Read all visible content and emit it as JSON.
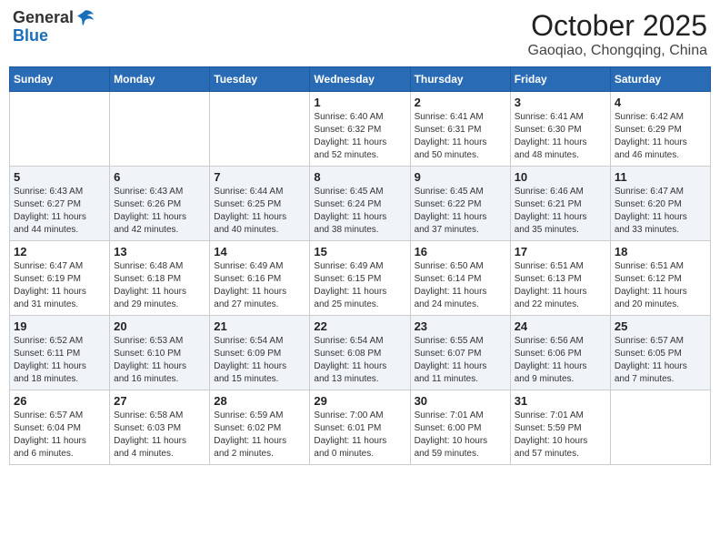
{
  "header": {
    "logo_general": "General",
    "logo_blue": "Blue",
    "month_title": "October 2025",
    "location": "Gaoqiao, Chongqing, China"
  },
  "weekdays": [
    "Sunday",
    "Monday",
    "Tuesday",
    "Wednesday",
    "Thursday",
    "Friday",
    "Saturday"
  ],
  "weeks": [
    [
      {
        "day": "",
        "info": ""
      },
      {
        "day": "",
        "info": ""
      },
      {
        "day": "",
        "info": ""
      },
      {
        "day": "1",
        "info": "Sunrise: 6:40 AM\nSunset: 6:32 PM\nDaylight: 11 hours\nand 52 minutes."
      },
      {
        "day": "2",
        "info": "Sunrise: 6:41 AM\nSunset: 6:31 PM\nDaylight: 11 hours\nand 50 minutes."
      },
      {
        "day": "3",
        "info": "Sunrise: 6:41 AM\nSunset: 6:30 PM\nDaylight: 11 hours\nand 48 minutes."
      },
      {
        "day": "4",
        "info": "Sunrise: 6:42 AM\nSunset: 6:29 PM\nDaylight: 11 hours\nand 46 minutes."
      }
    ],
    [
      {
        "day": "5",
        "info": "Sunrise: 6:43 AM\nSunset: 6:27 PM\nDaylight: 11 hours\nand 44 minutes."
      },
      {
        "day": "6",
        "info": "Sunrise: 6:43 AM\nSunset: 6:26 PM\nDaylight: 11 hours\nand 42 minutes."
      },
      {
        "day": "7",
        "info": "Sunrise: 6:44 AM\nSunset: 6:25 PM\nDaylight: 11 hours\nand 40 minutes."
      },
      {
        "day": "8",
        "info": "Sunrise: 6:45 AM\nSunset: 6:24 PM\nDaylight: 11 hours\nand 38 minutes."
      },
      {
        "day": "9",
        "info": "Sunrise: 6:45 AM\nSunset: 6:22 PM\nDaylight: 11 hours\nand 37 minutes."
      },
      {
        "day": "10",
        "info": "Sunrise: 6:46 AM\nSunset: 6:21 PM\nDaylight: 11 hours\nand 35 minutes."
      },
      {
        "day": "11",
        "info": "Sunrise: 6:47 AM\nSunset: 6:20 PM\nDaylight: 11 hours\nand 33 minutes."
      }
    ],
    [
      {
        "day": "12",
        "info": "Sunrise: 6:47 AM\nSunset: 6:19 PM\nDaylight: 11 hours\nand 31 minutes."
      },
      {
        "day": "13",
        "info": "Sunrise: 6:48 AM\nSunset: 6:18 PM\nDaylight: 11 hours\nand 29 minutes."
      },
      {
        "day": "14",
        "info": "Sunrise: 6:49 AM\nSunset: 6:16 PM\nDaylight: 11 hours\nand 27 minutes."
      },
      {
        "day": "15",
        "info": "Sunrise: 6:49 AM\nSunset: 6:15 PM\nDaylight: 11 hours\nand 25 minutes."
      },
      {
        "day": "16",
        "info": "Sunrise: 6:50 AM\nSunset: 6:14 PM\nDaylight: 11 hours\nand 24 minutes."
      },
      {
        "day": "17",
        "info": "Sunrise: 6:51 AM\nSunset: 6:13 PM\nDaylight: 11 hours\nand 22 minutes."
      },
      {
        "day": "18",
        "info": "Sunrise: 6:51 AM\nSunset: 6:12 PM\nDaylight: 11 hours\nand 20 minutes."
      }
    ],
    [
      {
        "day": "19",
        "info": "Sunrise: 6:52 AM\nSunset: 6:11 PM\nDaylight: 11 hours\nand 18 minutes."
      },
      {
        "day": "20",
        "info": "Sunrise: 6:53 AM\nSunset: 6:10 PM\nDaylight: 11 hours\nand 16 minutes."
      },
      {
        "day": "21",
        "info": "Sunrise: 6:54 AM\nSunset: 6:09 PM\nDaylight: 11 hours\nand 15 minutes."
      },
      {
        "day": "22",
        "info": "Sunrise: 6:54 AM\nSunset: 6:08 PM\nDaylight: 11 hours\nand 13 minutes."
      },
      {
        "day": "23",
        "info": "Sunrise: 6:55 AM\nSunset: 6:07 PM\nDaylight: 11 hours\nand 11 minutes."
      },
      {
        "day": "24",
        "info": "Sunrise: 6:56 AM\nSunset: 6:06 PM\nDaylight: 11 hours\nand 9 minutes."
      },
      {
        "day": "25",
        "info": "Sunrise: 6:57 AM\nSunset: 6:05 PM\nDaylight: 11 hours\nand 7 minutes."
      }
    ],
    [
      {
        "day": "26",
        "info": "Sunrise: 6:57 AM\nSunset: 6:04 PM\nDaylight: 11 hours\nand 6 minutes."
      },
      {
        "day": "27",
        "info": "Sunrise: 6:58 AM\nSunset: 6:03 PM\nDaylight: 11 hours\nand 4 minutes."
      },
      {
        "day": "28",
        "info": "Sunrise: 6:59 AM\nSunset: 6:02 PM\nDaylight: 11 hours\nand 2 minutes."
      },
      {
        "day": "29",
        "info": "Sunrise: 7:00 AM\nSunset: 6:01 PM\nDaylight: 11 hours\nand 0 minutes."
      },
      {
        "day": "30",
        "info": "Sunrise: 7:01 AM\nSunset: 6:00 PM\nDaylight: 10 hours\nand 59 minutes."
      },
      {
        "day": "31",
        "info": "Sunrise: 7:01 AM\nSunset: 5:59 PM\nDaylight: 10 hours\nand 57 minutes."
      },
      {
        "day": "",
        "info": ""
      }
    ]
  ]
}
